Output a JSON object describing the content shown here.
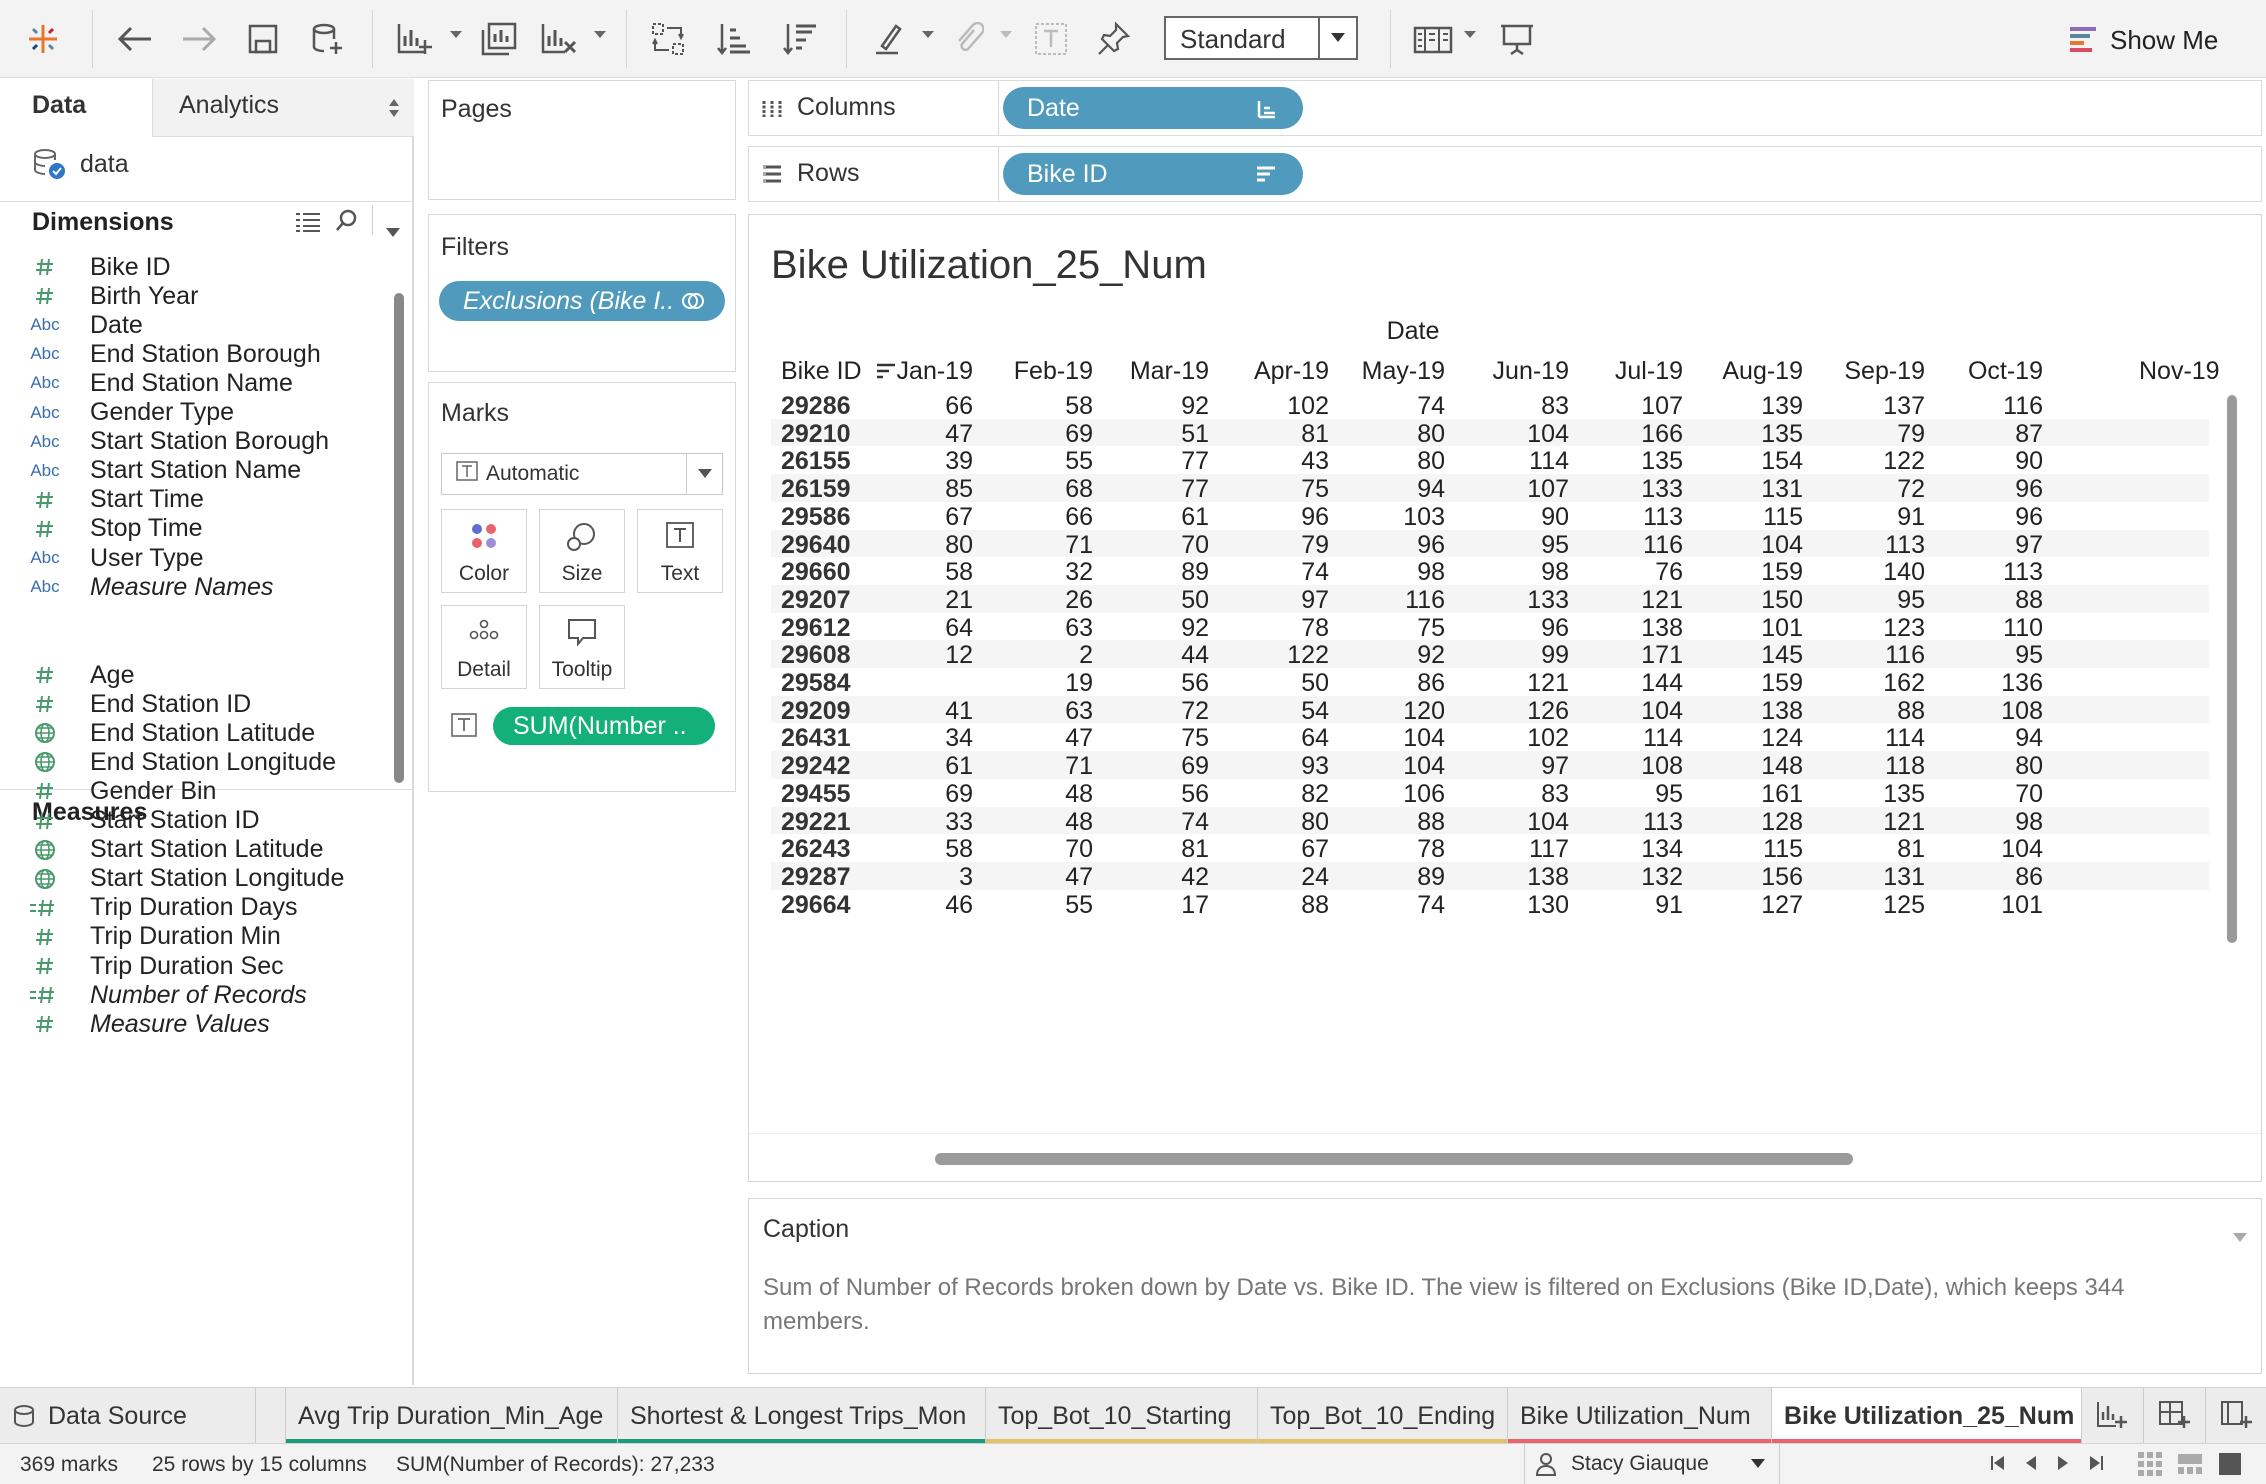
{
  "toolbar": {
    "mark_type_select": "Standard",
    "show_me_label": "Show Me"
  },
  "data_pane": {
    "tabs": {
      "data": "Data",
      "analytics": "Analytics"
    },
    "datasource": "data",
    "dimensions_title": "Dimensions",
    "dimensions": [
      {
        "label": "Bike ID",
        "type": "#"
      },
      {
        "label": "Birth Year",
        "type": "#"
      },
      {
        "label": "Date",
        "type": "Abc"
      },
      {
        "label": "End Station Borough",
        "type": "Abc"
      },
      {
        "label": "End Station Name",
        "type": "Abc"
      },
      {
        "label": "Gender Type",
        "type": "Abc"
      },
      {
        "label": "Start Station Borough",
        "type": "Abc"
      },
      {
        "label": "Start Station Name",
        "type": "Abc"
      },
      {
        "label": "Start Time",
        "type": "#"
      },
      {
        "label": "Stop Time",
        "type": "#"
      },
      {
        "label": "User Type",
        "type": "Abc"
      },
      {
        "label": "Measure Names",
        "type": "Abc"
      }
    ],
    "measures_title": "Measures",
    "measures": [
      {
        "label": "Age",
        "type": "#"
      },
      {
        "label": "End Station ID",
        "type": "#"
      },
      {
        "label": "End Station Latitude",
        "type": "globe"
      },
      {
        "label": "End Station Longitude",
        "type": "globe"
      },
      {
        "label": "Gender Bin",
        "type": "#"
      },
      {
        "label": "Start Station ID",
        "type": "#"
      },
      {
        "label": "Start Station Latitude",
        "type": "globe"
      },
      {
        "label": "Start Station Longitude",
        "type": "globe"
      },
      {
        "label": "Trip Duration Days",
        "type": "=#"
      },
      {
        "label": "Trip Duration Min",
        "type": "#"
      },
      {
        "label": "Trip Duration Sec",
        "type": "#"
      },
      {
        "label": "Number of Records",
        "type": "=#"
      },
      {
        "label": "Measure Values",
        "type": "#"
      }
    ]
  },
  "pages": {
    "title": "Pages"
  },
  "filters": {
    "title": "Filters",
    "pill": "Exclusions (Bike I.."
  },
  "marks": {
    "title": "Marks",
    "type": "Automatic",
    "buttons": {
      "color": "Color",
      "size": "Size",
      "text": "Text",
      "detail": "Detail",
      "tooltip": "Tooltip"
    },
    "pill": "SUM(Number .."
  },
  "shelves": {
    "columns_label": "Columns",
    "columns_pill": "Date",
    "rows_label": "Rows",
    "rows_pill": "Bike ID"
  },
  "view": {
    "title": "Bike Utilization_25_Num",
    "column_group": "Date",
    "row_header": "Bike ID",
    "months": [
      "Jan-19",
      "Feb-19",
      "Mar-19",
      "Apr-19",
      "May-19",
      "Jun-19",
      "Jul-19",
      "Aug-19",
      "Sep-19",
      "Oct-19",
      "Nov-19"
    ],
    "rows": [
      {
        "id": "29286",
        "v": [
          "66",
          "58",
          "92",
          "102",
          "74",
          "83",
          "107",
          "139",
          "137",
          "116"
        ]
      },
      {
        "id": "29210",
        "v": [
          "47",
          "69",
          "51",
          "81",
          "80",
          "104",
          "166",
          "135",
          "79",
          "87"
        ]
      },
      {
        "id": "26155",
        "v": [
          "39",
          "55",
          "77",
          "43",
          "80",
          "114",
          "135",
          "154",
          "122",
          "90"
        ]
      },
      {
        "id": "26159",
        "v": [
          "85",
          "68",
          "77",
          "75",
          "94",
          "107",
          "133",
          "131",
          "72",
          "96"
        ]
      },
      {
        "id": "29586",
        "v": [
          "67",
          "66",
          "61",
          "96",
          "103",
          "90",
          "113",
          "115",
          "91",
          "96"
        ]
      },
      {
        "id": "29640",
        "v": [
          "80",
          "71",
          "70",
          "79",
          "96",
          "95",
          "116",
          "104",
          "113",
          "97"
        ]
      },
      {
        "id": "29660",
        "v": [
          "58",
          "32",
          "89",
          "74",
          "98",
          "98",
          "76",
          "159",
          "140",
          "113"
        ]
      },
      {
        "id": "29207",
        "v": [
          "21",
          "26",
          "50",
          "97",
          "116",
          "133",
          "121",
          "150",
          "95",
          "88"
        ]
      },
      {
        "id": "29612",
        "v": [
          "64",
          "63",
          "92",
          "78",
          "75",
          "96",
          "138",
          "101",
          "123",
          "110"
        ]
      },
      {
        "id": "29608",
        "v": [
          "12",
          "2",
          "44",
          "122",
          "92",
          "99",
          "171",
          "145",
          "116",
          "95"
        ]
      },
      {
        "id": "29584",
        "v": [
          "",
          "19",
          "56",
          "50",
          "86",
          "121",
          "144",
          "159",
          "162",
          "136"
        ]
      },
      {
        "id": "29209",
        "v": [
          "41",
          "63",
          "72",
          "54",
          "120",
          "126",
          "104",
          "138",
          "88",
          "108"
        ]
      },
      {
        "id": "26431",
        "v": [
          "34",
          "47",
          "75",
          "64",
          "104",
          "102",
          "114",
          "124",
          "114",
          "94"
        ]
      },
      {
        "id": "29242",
        "v": [
          "61",
          "71",
          "69",
          "93",
          "104",
          "97",
          "108",
          "148",
          "118",
          "80"
        ]
      },
      {
        "id": "29455",
        "v": [
          "69",
          "48",
          "56",
          "82",
          "106",
          "83",
          "95",
          "161",
          "135",
          "70"
        ]
      },
      {
        "id": "29221",
        "v": [
          "33",
          "48",
          "74",
          "80",
          "88",
          "104",
          "113",
          "128",
          "121",
          "98"
        ]
      },
      {
        "id": "26243",
        "v": [
          "58",
          "70",
          "81",
          "67",
          "78",
          "117",
          "134",
          "115",
          "81",
          "104"
        ]
      },
      {
        "id": "29287",
        "v": [
          "3",
          "47",
          "42",
          "24",
          "89",
          "138",
          "132",
          "156",
          "131",
          "86"
        ]
      },
      {
        "id": "29664",
        "v": [
          "46",
          "55",
          "17",
          "88",
          "74",
          "130",
          "91",
          "127",
          "125",
          "101"
        ]
      }
    ]
  },
  "caption": {
    "title": "Caption",
    "text": "Sum of Number of Records broken down by Date vs. Bike ID. The view is filtered on Exclusions (Bike ID,Date), which keeps 344 members."
  },
  "sheet_tabs": [
    {
      "label": "Data Source",
      "color": "",
      "active": false
    },
    {
      "label": "Avg Trip Duration_Min_Age",
      "color": "#1a9b7a",
      "active": false
    },
    {
      "label": "Shortest & Longest Trips_Mon",
      "color": "#1a9b7a",
      "active": false
    },
    {
      "label": "Top_Bot_10_Starting",
      "color": "#e3c26a",
      "active": false
    },
    {
      "label": "Top_Bot_10_Ending",
      "color": "#e3c26a",
      "active": false
    },
    {
      "label": "Bike Utilization_Num",
      "color": "#e9636c",
      "active": false
    },
    {
      "label": "Bike Utilization_25_Num",
      "color": "#e9636c",
      "active": true
    }
  ],
  "status": {
    "marks": "369 marks",
    "rows_cols": "25 rows by 15 columns",
    "sum": "SUM(Number of Records): 27,233",
    "user": "Stacy Giauque"
  },
  "colors": {
    "dimension_pill": "#4f9abd",
    "measure_pill": "#14b07a",
    "accent": "#1a9b7a"
  }
}
